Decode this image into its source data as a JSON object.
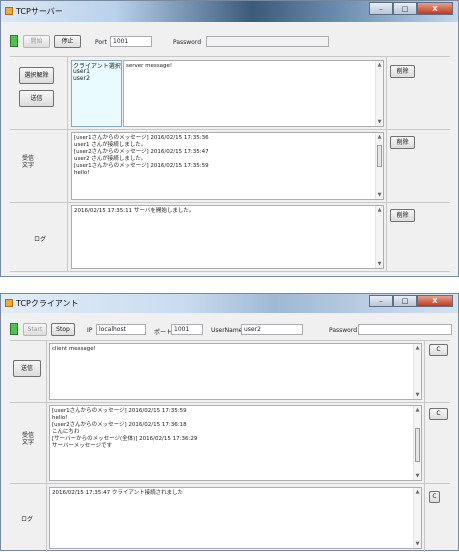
{
  "server": {
    "title": "TCPサーバー",
    "win_min": "–",
    "win_max": "□",
    "win_close": "X",
    "start_label": "開始",
    "stop_label": "停止",
    "port_label": "Port",
    "port_value": "1001",
    "password_label": "Password",
    "password_value": "",
    "disconnect_label": "選択解除",
    "send_label": "送信",
    "client_select_label": "クライアント選択",
    "clients": [
      "user1",
      "user2"
    ],
    "message_value": "server message!",
    "delete_label": "削除",
    "received_label": "受信\n文字",
    "received_lines": [
      "[user1さんからのメッセージ] 2016/02/15 17:35:36",
      "user1 さんが接続しました。",
      "",
      "[user2さんからのメッセージ] 2016/02/15 17:35:47",
      "user2 さんが接続しました。",
      "",
      "[user1さんからのメッセージ] 2016/02/15 17:35:59",
      "hello!"
    ],
    "log_label": "ログ",
    "log_lines": [
      "2016/02/15 17:35:11 サーバを開始しました。"
    ]
  },
  "client": {
    "title": "TCPクライアント",
    "win_min": "–",
    "win_max": "□",
    "win_close": "X",
    "start_label": "Start",
    "stop_label": "Stop",
    "ip_label": "IP",
    "ip_value": "localhost",
    "port_label": "ポート",
    "port_value": "1001",
    "username_label": "UserName",
    "username_value": "user2",
    "password_label": "Password",
    "password_value": "",
    "send_label": "送信",
    "message_value": "client message!",
    "clear_label": "C",
    "received_label": "受信\n文字",
    "received_lines": [
      "[user1さんからのメッセージ] 2016/02/15 17:35:59",
      "hello!",
      "",
      "[user2さんからのメッセージ] 2016/02/15 17:36:18",
      "こんにちわ",
      "",
      "[サーバーからのメッセージ(全体)] 2016/02/15 17:36:29",
      "サーバーメッセージです"
    ],
    "log_label": "ログ",
    "log_lines": [
      "2016/02/15 17:35:47 クライアント接続されました"
    ]
  },
  "colors": {
    "status_led": "#4ec24e",
    "client_list_bg": "#e9fbff"
  }
}
